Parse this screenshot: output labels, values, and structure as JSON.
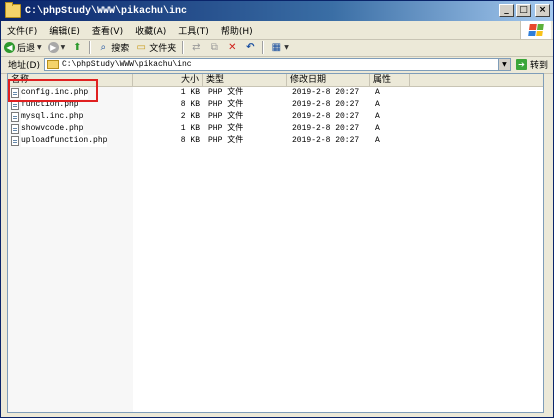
{
  "window": {
    "title": "C:\\phpStudy\\WWW\\pikachu\\inc"
  },
  "menu": [
    "文件(F)",
    "编辑(E)",
    "查看(V)",
    "收藏(A)",
    "工具(T)",
    "帮助(H)"
  ],
  "toolbar": {
    "back_label": "后退",
    "search_label": "搜索",
    "folders_label": "文件夹"
  },
  "address": {
    "label": "地址(D)",
    "value": "C:\\phpStudy\\WWW\\pikachu\\inc",
    "go_label": "转到"
  },
  "columns": {
    "name": "名称",
    "size": "大小",
    "type": "类型",
    "date": "修改日期",
    "attr": "属性"
  },
  "files": [
    {
      "name": "config.inc.php",
      "size": "1 KB",
      "type": "PHP 文件",
      "date": "2019-2-8 20:27",
      "attr": "A"
    },
    {
      "name": "function.php",
      "size": "8 KB",
      "type": "PHP 文件",
      "date": "2019-2-8 20:27",
      "attr": "A"
    },
    {
      "name": "mysql.inc.php",
      "size": "2 KB",
      "type": "PHP 文件",
      "date": "2019-2-8 20:27",
      "attr": "A"
    },
    {
      "name": "showvcode.php",
      "size": "1 KB",
      "type": "PHP 文件",
      "date": "2019-2-8 20:27",
      "attr": "A"
    },
    {
      "name": "uploadfunction.php",
      "size": "8 KB",
      "type": "PHP 文件",
      "date": "2019-2-8 20:27",
      "attr": "A"
    }
  ],
  "colors": {
    "titlebar": "#0a246a",
    "highlight": "#e02020",
    "go": "#3aa638"
  }
}
